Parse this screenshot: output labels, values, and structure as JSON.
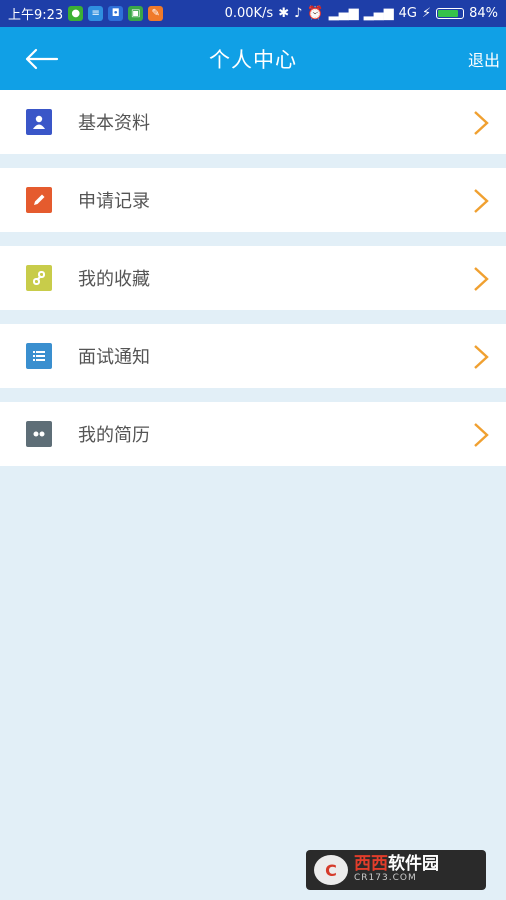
{
  "status_bar": {
    "time": "上午9:23",
    "speed": "0.00K/s",
    "network": "4G",
    "battery": "84%",
    "battery_level": 0.84
  },
  "header": {
    "title": "个人中心",
    "logout_label": "退出"
  },
  "menu": {
    "items": [
      {
        "label": "基本资料",
        "icon": "user-icon",
        "color": "#3a56c8"
      },
      {
        "label": "申请记录",
        "icon": "pencil-icon",
        "color": "#e55b2e"
      },
      {
        "label": "我的收藏",
        "icon": "link-icon",
        "color": "#c8cc4a"
      },
      {
        "label": "面试通知",
        "icon": "list-icon",
        "color": "#3a8fcf"
      },
      {
        "label": "我的简历",
        "icon": "resume-icon",
        "color": "#5e6e77"
      }
    ]
  },
  "watermark": {
    "brand_red": "西西",
    "brand_white": "软件园",
    "sub": "CR173.COM"
  },
  "colors": {
    "header": "#10a0e6",
    "status_bar": "#1e3ea8",
    "background": "#e2eff7",
    "chevron": "#f0a030"
  }
}
